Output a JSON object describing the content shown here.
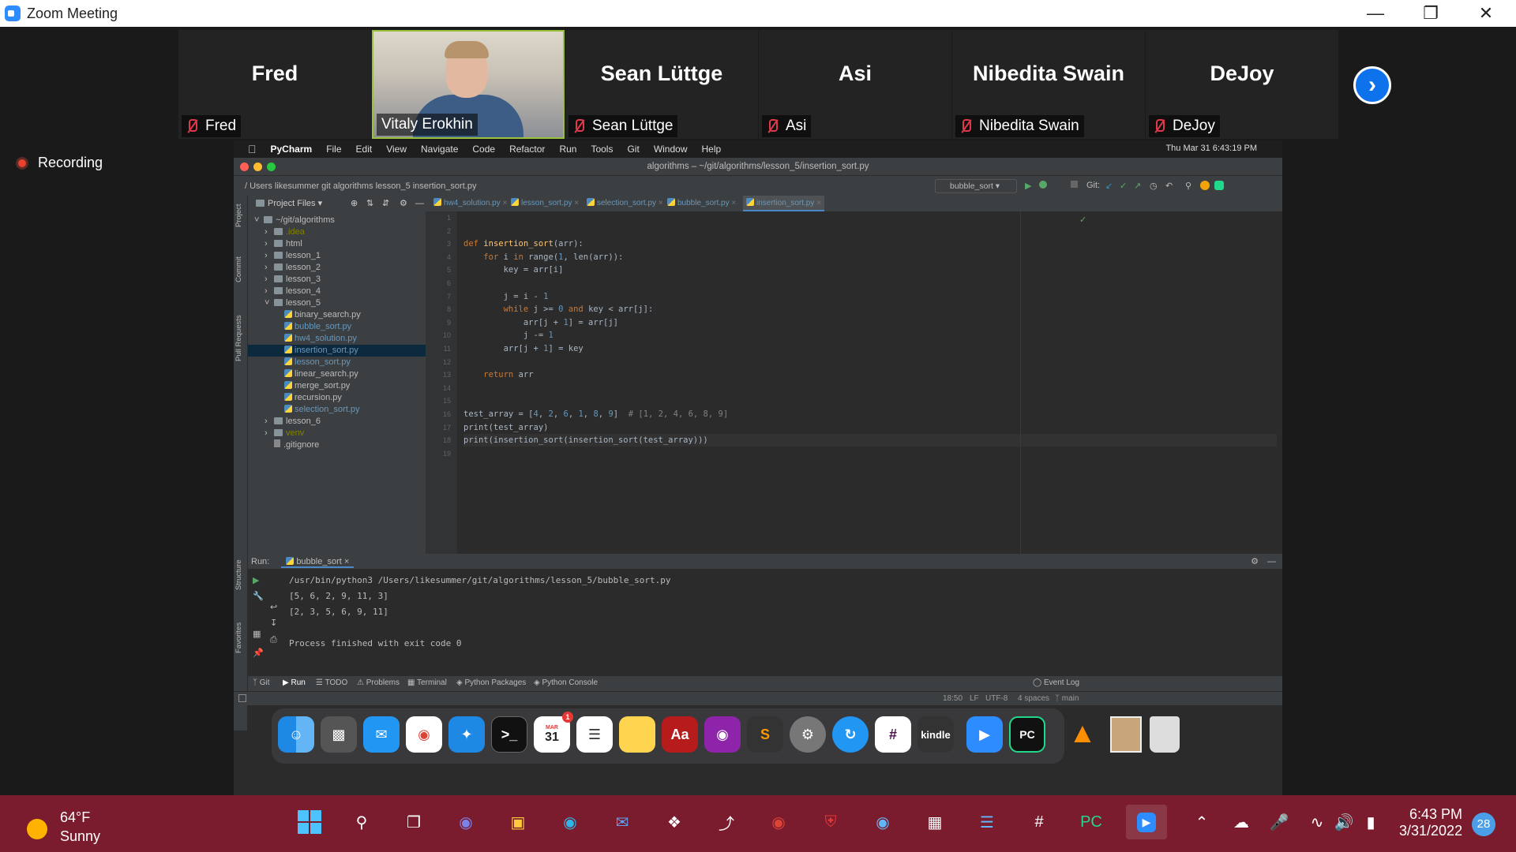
{
  "window": {
    "title": "Zoom Meeting",
    "controls": [
      "minimize",
      "restore",
      "close"
    ]
  },
  "participants": [
    {
      "name": "Fred",
      "label": "Fred",
      "video": false
    },
    {
      "name": "Vitaly Erokhin",
      "label": "Vitaly Erokhin",
      "video": true
    },
    {
      "name": "Sean Lüttge",
      "label": "Sean Lüttge",
      "video": false
    },
    {
      "name": "Asi",
      "label": "Asi",
      "video": false
    },
    {
      "name": "Nibedita Swain",
      "label": "Nibedita Swain",
      "video": false
    },
    {
      "name": "DeJoy",
      "label": "DeJoy",
      "video": false
    }
  ],
  "recording": "Recording",
  "mac": {
    "menubar": {
      "app": "PyCharm",
      "items": [
        "File",
        "Edit",
        "View",
        "Navigate",
        "Code",
        "Refactor",
        "Run",
        "Tools",
        "Git",
        "Window",
        "Help"
      ],
      "clock": "Thu Mar 31  6:43:19 PM"
    },
    "title": "algorithms – ~/git/algorithms/lesson_5/insertion_sort.py",
    "breadcrumb": "/   Users   likesummer   git   algorithms   lesson_5   insertion_sort.py",
    "run_config": "bubble_sort",
    "git_label": "Git:",
    "project_header": "Project Files",
    "tree": [
      {
        "t": "~/git/algorithms",
        "lvl": 0,
        "kind": "folder-open",
        "c": "#bbb"
      },
      {
        "t": ".idea",
        "lvl": 1,
        "kind": "folder",
        "c": "#808000"
      },
      {
        "t": "html",
        "lvl": 1,
        "kind": "folder",
        "c": "#bbb"
      },
      {
        "t": "lesson_1",
        "lvl": 1,
        "kind": "folder",
        "c": "#bbb"
      },
      {
        "t": "lesson_2",
        "lvl": 1,
        "kind": "folder",
        "c": "#bbb"
      },
      {
        "t": "lesson_3",
        "lvl": 1,
        "kind": "folder",
        "c": "#bbb"
      },
      {
        "t": "lesson_4",
        "lvl": 1,
        "kind": "folder",
        "c": "#bbb"
      },
      {
        "t": "lesson_5",
        "lvl": 1,
        "kind": "folder-open",
        "c": "#bbb"
      },
      {
        "t": "binary_search.py",
        "lvl": 2,
        "kind": "py",
        "c": "#bbb"
      },
      {
        "t": "bubble_sort.py",
        "lvl": 2,
        "kind": "py",
        "c": "#6897bb"
      },
      {
        "t": "hw4_solution.py",
        "lvl": 2,
        "kind": "py",
        "c": "#6897bb"
      },
      {
        "t": "insertion_sort.py",
        "lvl": 2,
        "kind": "py",
        "c": "#6897bb",
        "sel": true
      },
      {
        "t": "lesson_sort.py",
        "lvl": 2,
        "kind": "py",
        "c": "#6897bb"
      },
      {
        "t": "linear_search.py",
        "lvl": 2,
        "kind": "py",
        "c": "#bbb"
      },
      {
        "t": "merge_sort.py",
        "lvl": 2,
        "kind": "py",
        "c": "#bbb"
      },
      {
        "t": "recursion.py",
        "lvl": 2,
        "kind": "py",
        "c": "#bbb"
      },
      {
        "t": "selection_sort.py",
        "lvl": 2,
        "kind": "py",
        "c": "#6897bb"
      },
      {
        "t": "lesson_6",
        "lvl": 1,
        "kind": "folder",
        "c": "#bbb"
      },
      {
        "t": "venv",
        "lvl": 1,
        "kind": "folder",
        "c": "#808000"
      },
      {
        "t": ".gitignore",
        "lvl": 1,
        "kind": "file",
        "c": "#bbb"
      }
    ],
    "tabs": [
      "hw4_solution.py",
      "lesson_sort.py",
      "selection_sort.py",
      "bubble_sort.py",
      "insertion_sort.py"
    ],
    "active_tab": "insertion_sort.py",
    "code": [
      "",
      "",
      "def insertion_sort(arr):",
      "    for i in range(1, len(arr)):",
      "        key = arr[i]",
      "",
      "        j = i - 1",
      "        while j >= 0 and key < arr[j]:",
      "            arr[j + 1] = arr[j]",
      "            j -= 1",
      "        arr[j + 1] = key",
      "",
      "    return arr",
      "",
      "",
      "test_array = [4, 2, 6, 1, 8, 9]  # [1, 2, 4, 6, 8, 9]",
      "print(test_array)",
      "print(insertion_sort(insertion_sort(test_array)))",
      ""
    ],
    "run": {
      "label": "Run:",
      "tab": "bubble_sort",
      "output": [
        "/usr/bin/python3 /Users/likesummer/git/algorithms/lesson_5/bubble_sort.py",
        "[5, 6, 2, 9, 11, 3]",
        "[2, 3, 5, 6, 9, 11]",
        "",
        "Process finished with exit code 0"
      ]
    },
    "bottom_tabs": [
      "Git",
      "Run",
      "TODO",
      "Problems",
      "Terminal",
      "Python Packages",
      "Python Console"
    ],
    "event_log": "Event Log",
    "status": {
      "pos": "18:50",
      "eol": "LF",
      "enc": "UTF-8",
      "indent": "4 spaces",
      "branch": "main"
    },
    "side_labels": [
      "Project",
      "Commit",
      "Pull Requests",
      "Structure",
      "Favorites"
    ],
    "dock_calendar": {
      "month": "MAR",
      "day": "31",
      "badge": "1"
    }
  },
  "taskbar": {
    "temp": "64°F",
    "condition": "Sunny",
    "time": "6:43 PM",
    "date": "3/31/2022",
    "notifications": "28"
  },
  "colors": {
    "zoom_blue": "#0e72ed",
    "muted_red": "#e0384b",
    "taskbar": "#7a1c2d",
    "pycharm_bg": "#2b2b2b"
  }
}
